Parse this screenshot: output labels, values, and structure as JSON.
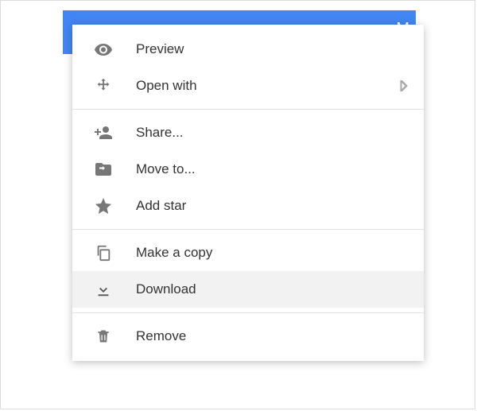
{
  "colors": {
    "blue": "#4285f4",
    "highlight": "#f2f2f2",
    "icon": "#777777",
    "text": "#333333",
    "divider": "#e2e2e2"
  },
  "blue_bar_fragment": "M",
  "menu": {
    "items": {
      "preview": "Preview",
      "open_with": "Open with",
      "share": "Share...",
      "move_to": "Move to...",
      "add_star": "Add star",
      "make_copy": "Make a copy",
      "download": "Download",
      "remove": "Remove"
    },
    "highlighted": "download"
  }
}
